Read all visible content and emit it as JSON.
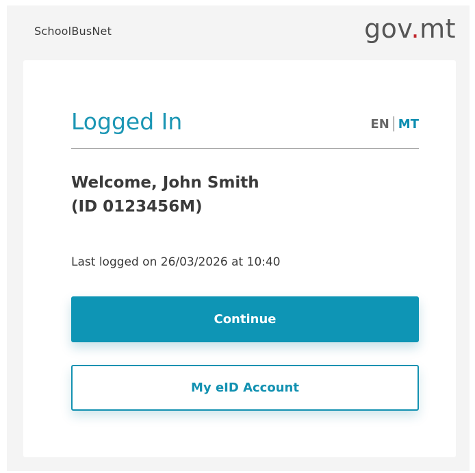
{
  "header": {
    "app_name": "SchoolBusNet",
    "logo_prefix": "gov",
    "logo_dot": ".",
    "logo_suffix": "mt"
  },
  "card": {
    "title": "Logged In",
    "languages": {
      "en": "EN",
      "mt": "MT"
    },
    "welcome_line1": "Welcome, John Smith",
    "welcome_line2": "(ID 0123456M)",
    "last_logged": "Last logged on 26/03/2026 at 10:40",
    "continue_label": "Continue",
    "eid_account_label": "My eID Account"
  },
  "colors": {
    "accent": "#0e95b5",
    "logo_dot": "#c0282d",
    "text": "#3a3a3a"
  }
}
